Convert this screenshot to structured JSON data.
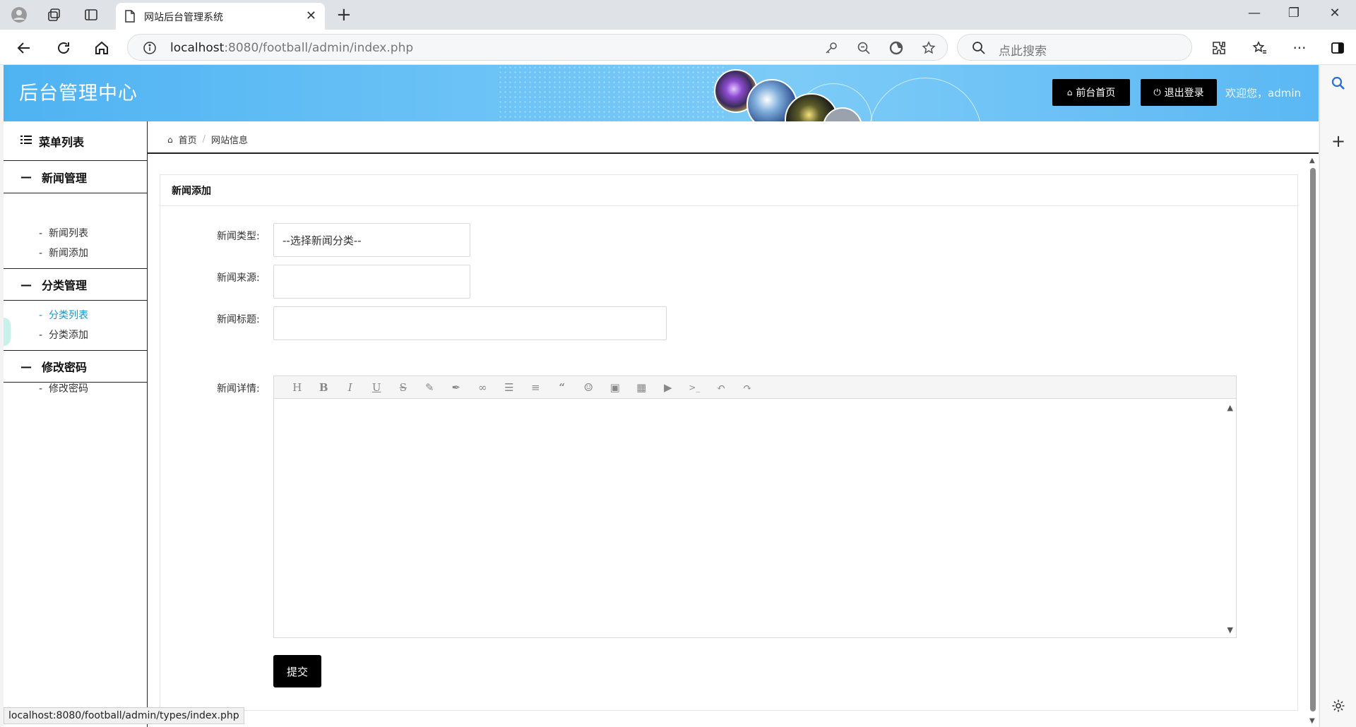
{
  "browser": {
    "tab_title": "网站后台管理系统",
    "url_host": "localhost",
    "url_rest": ":8080/football/admin/index.php",
    "search_placeholder": "点此搜索",
    "status_url": "localhost:8080/football/admin/types/index.php"
  },
  "header": {
    "logo": "后台管理中心",
    "home_button": "前台首页",
    "logout_button": "退出登录",
    "welcome": "欢迎您，admin"
  },
  "sidebar": {
    "menu_title": "菜单列表",
    "groups": [
      {
        "label": "新闻管理",
        "items": [
          "新闻列表",
          "新闻添加"
        ]
      },
      {
        "label": "分类管理",
        "items": [
          "分类列表",
          "分类添加"
        ]
      },
      {
        "label": "修改密码",
        "items": [
          "修改密码"
        ]
      }
    ],
    "active_item": "分类列表"
  },
  "breadcrumb": {
    "home": "首页",
    "current": "网站信息"
  },
  "form": {
    "panel_title": "新闻添加",
    "type_label": "新闻类型:",
    "type_value": "--选择新闻分类--",
    "source_label": "新闻来源:",
    "source_value": "",
    "title_label": "新闻标题:",
    "title_value": "",
    "detail_label": "新闻详情:",
    "submit": "提交"
  },
  "colors": {
    "header_bg": "#5bb8f4",
    "active_link": "#1797c9",
    "button_bg": "#000000"
  }
}
